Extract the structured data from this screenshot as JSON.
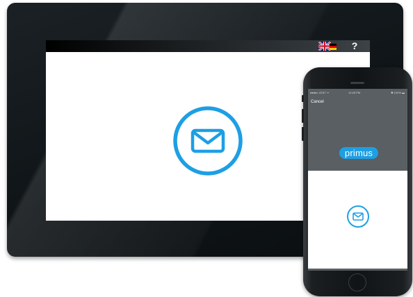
{
  "tablet": {
    "language_flag_icon": "flag-uk-de-icon",
    "help_label": "?",
    "main_icon": "envelope-circle-icon"
  },
  "phone": {
    "status": {
      "carrier": "●●●●○ AT&T ᯤ",
      "time": "12:45 PM",
      "battery": "✱ 100% ▬"
    },
    "cancel_label": "Cancel",
    "brand_label": "primus",
    "main_icon": "envelope-circle-icon"
  },
  "colors": {
    "accent": "#1d9fe4",
    "device_frame": "#111416",
    "phone_screen_bg": "#5a5f63"
  }
}
